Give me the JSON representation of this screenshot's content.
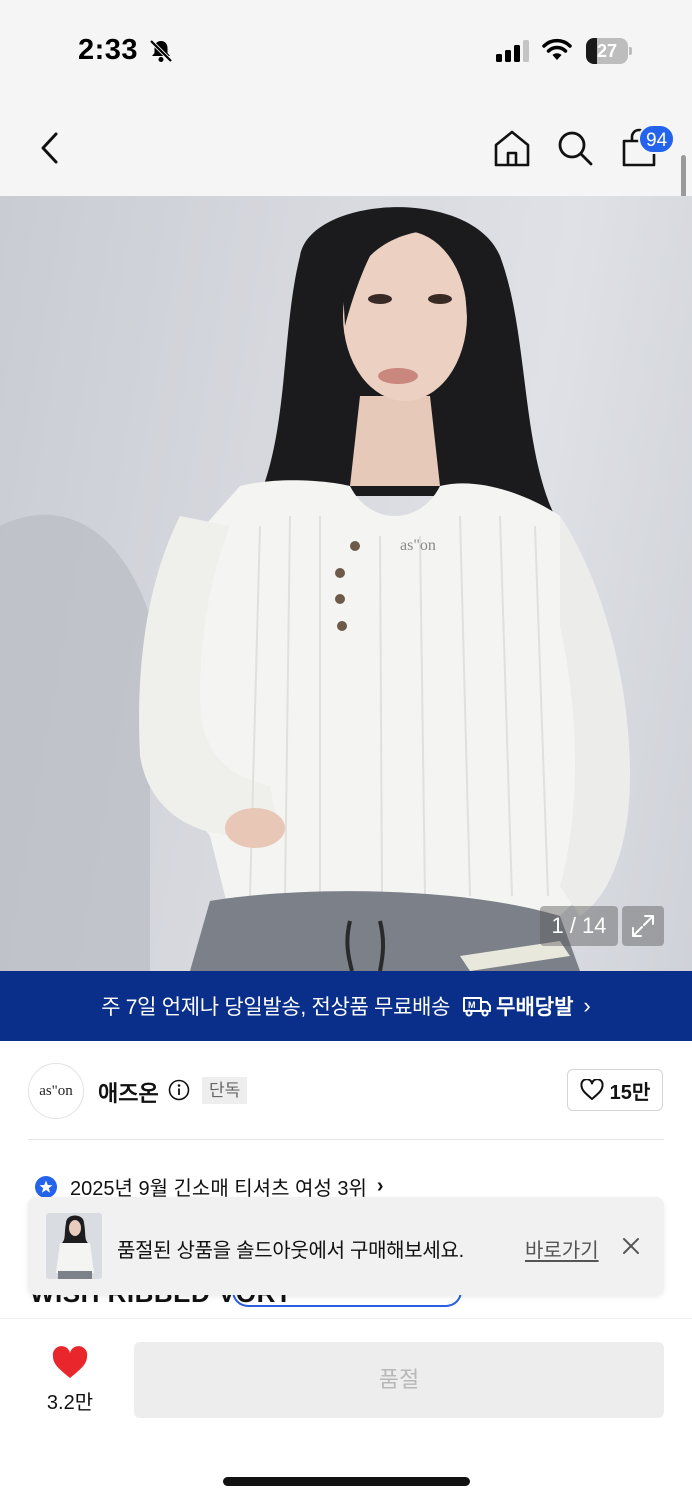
{
  "status_bar": {
    "time": "2:33",
    "battery_level": "27",
    "battery_fraction": 0.27,
    "icons": [
      "bell-off-icon",
      "signal-icon",
      "wifi-icon",
      "battery-icon"
    ]
  },
  "nav": {
    "back_icon": "chevron-left-icon",
    "home_icon": "home-icon",
    "search_icon": "search-icon",
    "cart_icon": "shopping-bag-icon",
    "cart_badge": "94"
  },
  "gallery": {
    "counter": "1 / 14",
    "expand_icon": "expand-icon",
    "shirt_logo": "as\"on"
  },
  "shipping_banner": {
    "text": "주 7일 언제나 당일발송, 전상품 무료배송",
    "logo_text": "무배당발",
    "logo_icon": "delivery-truck-icon",
    "chevron": "›"
  },
  "brand": {
    "avatar_text": "as\"on",
    "name": "애즈온",
    "info_icon": "info-icon",
    "tag": "단독",
    "like_count": "15만"
  },
  "ranking": {
    "text": "2025년 9월 긴소매 티셔츠 여성 3위",
    "chevron": "›"
  },
  "product": {
    "title_partial": "WISH RIBBED                          VORY"
  },
  "toast": {
    "message": "품절된 상품을 솔드아웃에서 구매해보세요.",
    "link": "바로가기",
    "close_icon": "close-icon"
  },
  "bottom_bar": {
    "wish_count": "3.2만",
    "soldout_label": "품절"
  },
  "colors": {
    "accent_blue": "#2463eb",
    "banner_navy": "#0a2f8b",
    "heart_red": "#e8262b",
    "disabled_gray": "#ededed"
  }
}
